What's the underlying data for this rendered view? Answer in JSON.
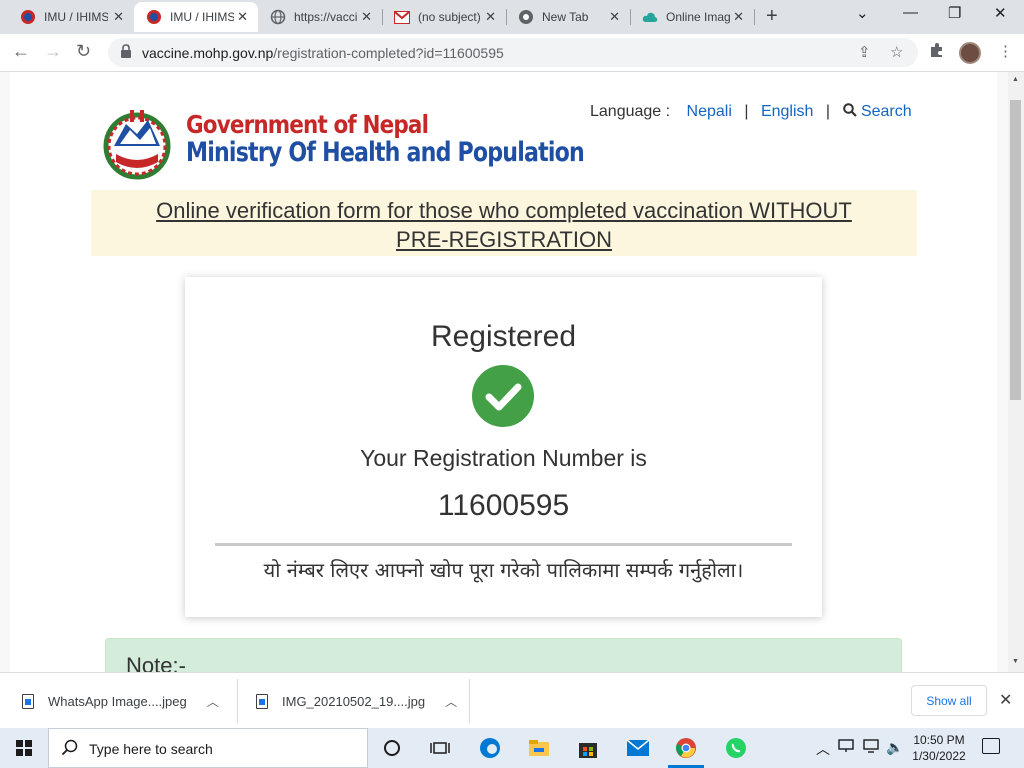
{
  "browser": {
    "tabs": [
      {
        "title": "IMU / IHIMS",
        "icon": "nepal-emblem-icon",
        "active": false
      },
      {
        "title": "IMU / IHIMS",
        "icon": "nepal-emblem-icon",
        "active": true
      },
      {
        "title": "https://vaccine.mohp",
        "icon": "globe-icon",
        "active": false
      },
      {
        "title": "(no subject)",
        "icon": "gmail-icon",
        "active": false
      },
      {
        "title": "New Tab",
        "icon": "chrome-icon",
        "active": false
      },
      {
        "title": "Online Image",
        "icon": "cloud-icon",
        "active": false
      }
    ],
    "url_domain": "vaccine.mohp.gov.np",
    "url_path": "/registration-completed?id=11600595"
  },
  "header": {
    "gov_name": "Government of Nepal",
    "ministry_name": "Ministry Of Health and Population",
    "language_label": "Language :",
    "lang_nepali": "Nepali",
    "lang_english": "English",
    "search_label": "Search",
    "separator": "|"
  },
  "banner": {
    "line1": "Online verification form for those who completed vaccination WITHOUT",
    "line2": "PRE-REGISTRATION"
  },
  "registration": {
    "heading": "Registered",
    "number_label": "Your Registration Number is",
    "number": "11600595",
    "nepali_instruction": "यो नंम्बर लिएर आफ्नो खोप पूरा गरेको पालिकामा सम्पर्क गर्नुहोला।"
  },
  "note": {
    "label": "Note:-"
  },
  "downloads": {
    "items": [
      {
        "filename": "WhatsApp Image....jpeg"
      },
      {
        "filename": "IMG_20210502_19....jpg"
      }
    ],
    "show_all": "Show all"
  },
  "taskbar": {
    "search_placeholder": "Type here to search",
    "time": "10:50 PM",
    "date": "1/30/2022"
  },
  "colors": {
    "accent_green": "#43a047",
    "gov_red": "#c62828",
    "ministry_blue": "#1f4fa3",
    "link_blue": "#1565c0",
    "banner_bg": "#fdf6df",
    "note_bg": "#d4edda"
  }
}
